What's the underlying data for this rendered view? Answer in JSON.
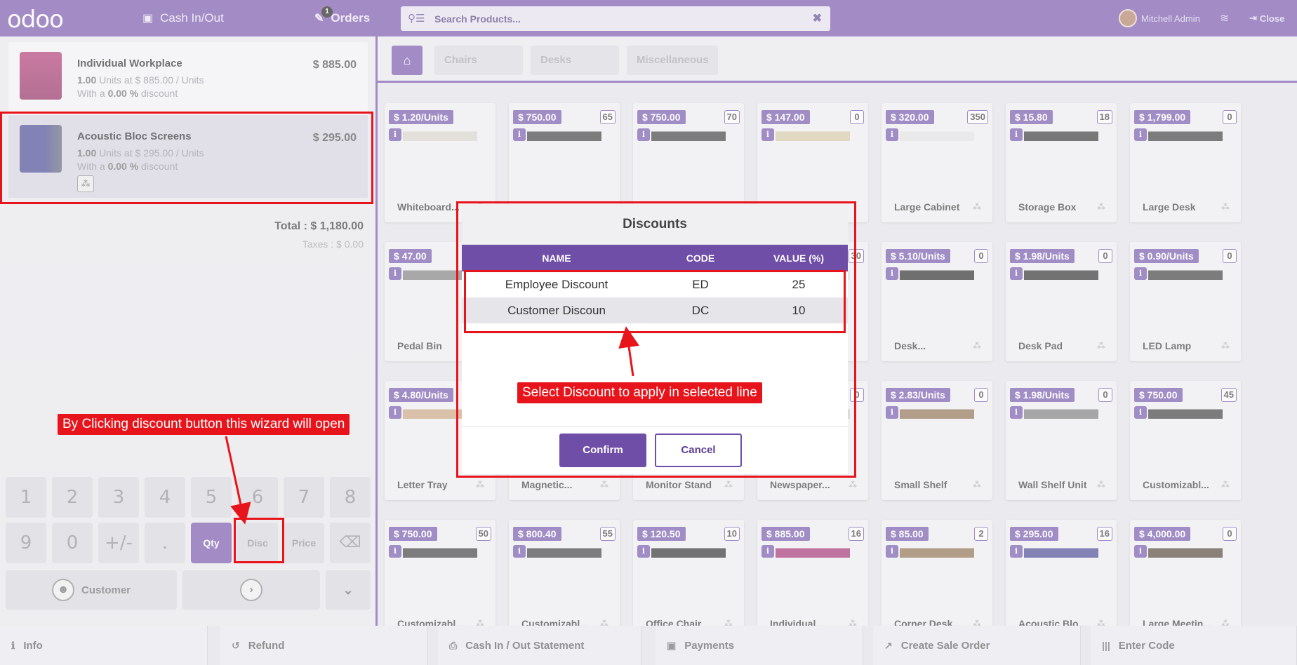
{
  "topbar": {
    "logo": "odoo",
    "cash_in_out": "Cash In/Out",
    "orders_label": "Orders",
    "orders_count": "1",
    "search_placeholder": "Search Products...",
    "user_name": "Mitchell Admin",
    "close_label": "Close"
  },
  "order": {
    "lines": [
      {
        "name": "Individual Workplace",
        "price": "$ 885.00",
        "qty": "1.00",
        "qty_text": " Units at $ 885.00 / Units",
        "disc_prefix": "With a ",
        "disc": "0.00 %",
        "disc_suffix": " discount"
      },
      {
        "name": "Acoustic Bloc Screens",
        "price": "$ 295.00",
        "qty": "1.00",
        "qty_text": " Units at $ 295.00 / Units",
        "disc_prefix": "With a ",
        "disc": "0.00 %",
        "disc_suffix": " discount"
      }
    ],
    "total": "Total : $ 1,180.00",
    "taxes": "Taxes : $ 0.00"
  },
  "numpad": {
    "keys": [
      "1",
      "2",
      "3",
      "4",
      "5",
      "6",
      "7",
      "8",
      "9",
      "0",
      "+/-",
      "."
    ],
    "qty": "Qty",
    "disc": "Disc",
    "price": "Price",
    "backspace": "⌫",
    "customer": "Customer",
    "next": "›",
    "more": "⌄"
  },
  "categories": {
    "home": "⌂",
    "items": [
      "Chairs",
      "Desks",
      "Miscellaneous"
    ]
  },
  "products": [
    {
      "price": "$ 1.20/Units",
      "stock": "",
      "name": "Whiteboard..."
    },
    {
      "price": "$ 750.00",
      "stock": "65",
      "name": ""
    },
    {
      "price": "$ 750.00",
      "stock": "70",
      "name": ""
    },
    {
      "price": "$ 147.00",
      "stock": "0",
      "name": ""
    },
    {
      "price": "$ 320.00",
      "stock": "350",
      "name": "Large Cabinet"
    },
    {
      "price": "$ 15.80",
      "stock": "18",
      "name": "Storage Box"
    },
    {
      "price": "$ 1,799.00",
      "stock": "0",
      "name": "Large Desk"
    },
    {
      "price": "$ 47.00",
      "stock": "",
      "name": "Pedal Bin"
    },
    {
      "price": "",
      "stock": "",
      "name": ""
    },
    {
      "price": "",
      "stock": "",
      "name": ""
    },
    {
      "price": "",
      "stock": "30",
      "name": ""
    },
    {
      "price": "$ 5.10/Units",
      "stock": "0",
      "name": "Desk..."
    },
    {
      "price": "$ 1.98/Units",
      "stock": "0",
      "name": "Desk Pad"
    },
    {
      "price": "$ 0.90/Units",
      "stock": "0",
      "name": "LED Lamp"
    },
    {
      "price": "$ 4.80/Units",
      "stock": "",
      "name": "Letter Tray"
    },
    {
      "price": "",
      "stock": "",
      "name": "Magnetic..."
    },
    {
      "price": "",
      "stock": "",
      "name": "Monitor Stand"
    },
    {
      "price": "",
      "stock": "0",
      "name": "Newspaper..."
    },
    {
      "price": "$ 2.83/Units",
      "stock": "0",
      "name": "Small Shelf"
    },
    {
      "price": "$ 1.98/Units",
      "stock": "0",
      "name": "Wall Shelf Unit"
    },
    {
      "price": "$ 750.00",
      "stock": "45",
      "name": "Customizabl..."
    },
    {
      "price": "$ 750.00",
      "stock": "50",
      "name": "Customizabl..."
    },
    {
      "price": "$ 800.40",
      "stock": "55",
      "name": "Customizabl..."
    },
    {
      "price": "$ 120.50",
      "stock": "10",
      "name": "Office Chair"
    },
    {
      "price": "$ 885.00",
      "stock": "16",
      "name": "Individual..."
    },
    {
      "price": "$ 85.00",
      "stock": "2",
      "name": "Corner Desk..."
    },
    {
      "price": "$ 295.00",
      "stock": "16",
      "name": "Acoustic Blo..."
    },
    {
      "price": "$ 4,000.00",
      "stock": "0",
      "name": "Large Meetin..."
    }
  ],
  "bottombar": [
    "Info",
    "Refund",
    "Cash In / Out Statement",
    "Payments",
    "Create Sale Order",
    "Enter Code"
  ],
  "modal": {
    "title": "Discounts",
    "headers": [
      "NAME",
      "CODE",
      "VALUE (%)"
    ],
    "rows": [
      {
        "name": "Employee Discount",
        "code": "ED",
        "value": "25"
      },
      {
        "name": "Customer Discoun",
        "code": "DC",
        "value": "10"
      }
    ],
    "confirm": "Confirm",
    "cancel": "Cancel"
  },
  "annotations": {
    "select_hint": "Select Discount to apply in selected line",
    "wizard_hint": "By Clicking discount button this wizard will open"
  },
  "colors": {
    "brand": "#714ba8",
    "annotation": "#e8141b"
  }
}
